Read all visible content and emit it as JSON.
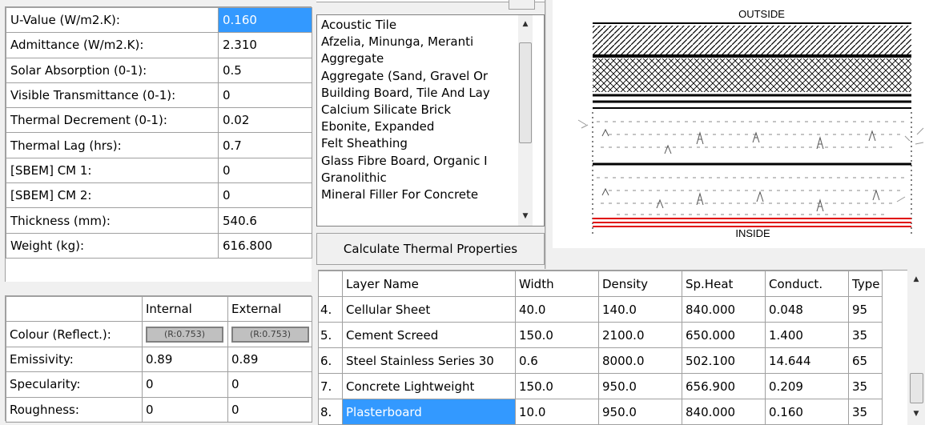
{
  "properties": [
    {
      "label": "U-Value (W/m2.K):",
      "value": "0.160",
      "selected": true
    },
    {
      "label": "Admittance (W/m2.K):",
      "value": "2.310"
    },
    {
      "label": "Solar Absorption (0-1):",
      "value": "0.5"
    },
    {
      "label": "Visible Transmittance (0-1):",
      "value": "0"
    },
    {
      "label": "Thermal Decrement (0-1):",
      "value": "0.02"
    },
    {
      "label": "Thermal Lag (hrs):",
      "value": "0.7"
    },
    {
      "label": "[SBEM] CM 1:",
      "value": "0"
    },
    {
      "label": "[SBEM] CM 2:",
      "value": "0"
    },
    {
      "label": "Thickness (mm):",
      "value": "540.6"
    },
    {
      "label": "Weight (kg):",
      "value": "616.800"
    }
  ],
  "surface": {
    "headers": [
      "",
      "Internal",
      "External"
    ],
    "colour_label": "Colour (Reflect.):",
    "colour_internal": "(R:0.753)",
    "colour_external": "(R:0.753)",
    "rows": [
      {
        "label": "Emissivity:",
        "internal": "0.89",
        "external": "0.89"
      },
      {
        "label": "Specularity:",
        "internal": "0",
        "external": "0"
      },
      {
        "label": "Roughness:",
        "internal": "0",
        "external": "0"
      }
    ]
  },
  "materials": {
    "items": [
      "Acoustic Tile",
      "Afzelia, Minunga, Meranti",
      "Aggregate",
      "Aggregate (Sand, Gravel Or",
      "Building Board, Tile And Lay",
      "Calcium Silicate Brick",
      "Ebonite, Expanded",
      "Felt Sheathing",
      "Glass Fibre Board, Organic I",
      "Granolithic",
      "Mineral Filler For Concrete"
    ],
    "calc_button": "Calculate Thermal Properties"
  },
  "diagram": {
    "outside_label": "OUTSIDE",
    "inside_label": "INSIDE",
    "highlight_color": "#e00000"
  },
  "layers": {
    "headers": [
      "Layer Name",
      "Width",
      "Density",
      "Sp.Heat",
      "Conduct.",
      "Type"
    ],
    "rows": [
      {
        "num": "4.",
        "name": "Cellular Sheet",
        "width": "40.0",
        "density": "140.0",
        "spheat": "840.000",
        "conduct": "0.048",
        "type": "95"
      },
      {
        "num": "5.",
        "name": "Cement Screed",
        "width": "150.0",
        "density": "2100.0",
        "spheat": "650.000",
        "conduct": "1.400",
        "type": "35"
      },
      {
        "num": "6.",
        "name": "Steel Stainless Series 30",
        "width": "0.6",
        "density": "8000.0",
        "spheat": "502.100",
        "conduct": "14.644",
        "type": "65"
      },
      {
        "num": "7.",
        "name": "Concrete Lightweight",
        "width": "150.0",
        "density": "950.0",
        "spheat": "656.900",
        "conduct": "0.209",
        "type": "35"
      },
      {
        "num": "8.",
        "name": "Plasterboard",
        "width": "10.0",
        "density": "950.0",
        "spheat": "840.000",
        "conduct": "0.160",
        "type": "35",
        "selected": true
      }
    ]
  },
  "accent_color": "#3399ff"
}
